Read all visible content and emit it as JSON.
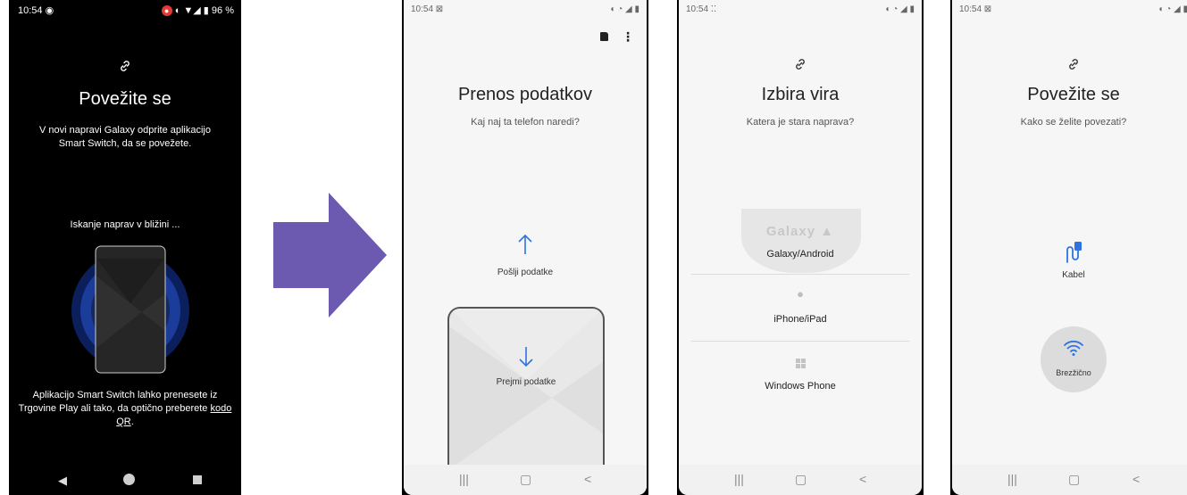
{
  "screen1": {
    "status": {
      "time": "10:54",
      "indicator": "◉",
      "battery": "96 %"
    },
    "title": "Povežite se",
    "description": "V novi napravi Galaxy odprite aplikacijo Smart Switch, da se povežete.",
    "searching": "Iskanje naprav v bližini ...",
    "footer_text": "Aplikacijo Smart Switch lahko prenesete iz Trgovine Play ali tako, da optično preberete ",
    "qr_link": "kodo QR",
    "footer_end": "."
  },
  "screen2": {
    "status": {
      "time": "10:54"
    },
    "title": "Prenos podatkov",
    "subtitle": "Kaj naj ta telefon naredi?",
    "send_label": "Pošlji podatke",
    "receive_label": "Prejmi podatke"
  },
  "screen3": {
    "status": {
      "time": "10:54"
    },
    "title": "Izbira vira",
    "subtitle": "Katera je stara naprava?",
    "galaxy_logo": "Galaxy",
    "options": [
      "Galaxy/Android",
      "iPhone/iPad",
      "Windows Phone"
    ]
  },
  "screen4": {
    "status": {
      "time": "10:54"
    },
    "title": "Povežite se",
    "subtitle": "Kako se želite povezati?",
    "cable_label": "Kabel",
    "wireless_label": "Brezžično"
  },
  "colors": {
    "accent_blue": "#2f73e0",
    "arrow_purple": "#6b5ab0",
    "dark_bg": "#000000",
    "light_bg": "#f6f6f6"
  },
  "icons": [
    "link-icon",
    "sd-card-icon",
    "more-icon",
    "arrow-up-icon",
    "arrow-down-icon",
    "android-icon",
    "apple-icon",
    "windows-icon",
    "usb-cable-icon",
    "wifi-icon"
  ]
}
